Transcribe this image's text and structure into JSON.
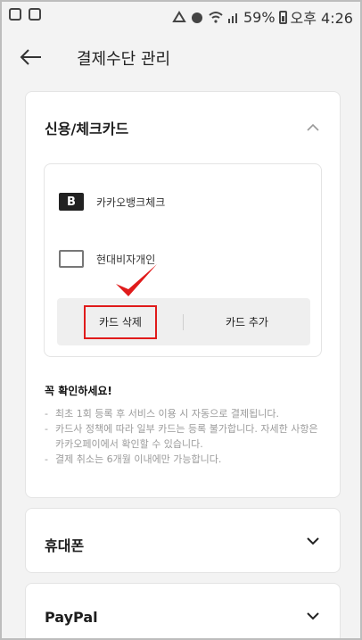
{
  "status_bar": {
    "battery_percent": "59%",
    "time": "오후 4:26",
    "icons": [
      "app-icon",
      "image-icon",
      "triangle-icon",
      "alarm-icon",
      "wifi-icon",
      "signal-icon",
      "battery-icon"
    ]
  },
  "header": {
    "title": "결제수단 관리",
    "back_icon": "arrow-left-icon"
  },
  "credit_section": {
    "title": "신용/체크카드",
    "expanded": true,
    "cards": [
      {
        "name": "카카오뱅크체크",
        "logo": "kakaobank-logo",
        "logo_letter": "B"
      },
      {
        "name": "현대비자개인",
        "logo": "hyundai-card-logo"
      }
    ],
    "delete_label": "카드 삭제",
    "add_label": "카드 추가",
    "notice_title": "꼭 확인하세요!",
    "notices": [
      "최초 1회 등록 후 서비스 이용 시 자동으로 결제됩니다.",
      "카드사 정책에 따라 일부 카드는 등록 불가합니다. 자세한 사항은 카카오페이에서 확인할 수 있습니다.",
      "결제 취소는 6개월 이내에만 가능합니다."
    ]
  },
  "phone_section": {
    "title": "휴대폰",
    "expanded": false
  },
  "paypal_section": {
    "title": "PayPal",
    "expanded": false
  },
  "colors": {
    "highlight": "#e01b1b",
    "background": "#f3f3f3",
    "card": "#ffffff"
  }
}
